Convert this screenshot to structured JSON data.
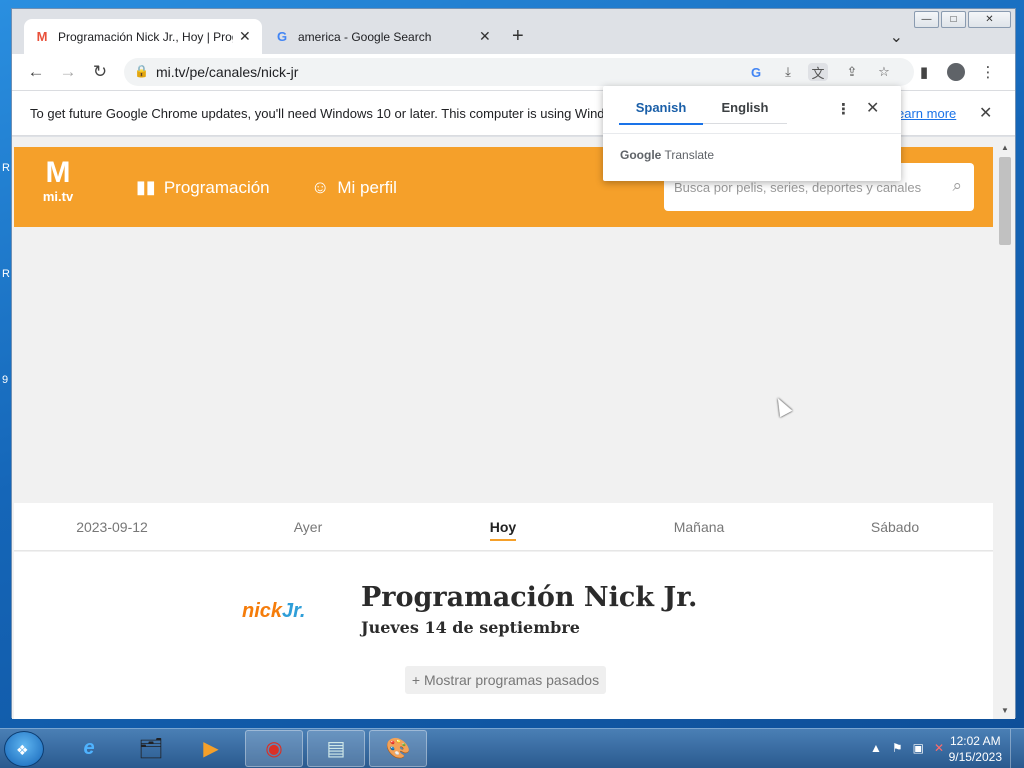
{
  "desktop": {
    "edge_letters": [
      "R",
      "R",
      "9"
    ]
  },
  "window": {
    "controls": {
      "minimize": "—",
      "maximize": "□",
      "close": "✕"
    }
  },
  "tabs": [
    {
      "title": "Programación Nick Jr., Hoy | Prog",
      "favicon": "M",
      "close": "✕"
    },
    {
      "title": "america - Google Search",
      "favicon": "G",
      "close": "✕"
    }
  ],
  "new_tab": "+",
  "tab_search": "⌄",
  "toolbar": {
    "back": "←",
    "forward": "→",
    "reload": "↻",
    "url": "mi.tv/pe/canales/nick-jr",
    "lock": "🔒",
    "icons": {
      "google": "G",
      "install": "⤓",
      "translate": "文",
      "share": "⇪",
      "bookmark": "☆",
      "side_panel": "▮",
      "menu": "⋮"
    }
  },
  "infobar": {
    "message": "To get future Google Chrome updates, you'll need Windows 10 or later. This computer is using Wind",
    "link": "earn more",
    "close": "✕"
  },
  "site": {
    "logo_mark": "M",
    "logo_text": "mi.tv",
    "nav": [
      {
        "label": "Programación",
        "icon": "book-open-icon"
      },
      {
        "label": "Mi perfil",
        "icon": "profile-face-icon"
      }
    ],
    "search_placeholder": "Busca por pelis, series, deportes y canales",
    "search_icon": "⌕"
  },
  "days": [
    {
      "label": "2023-09-12",
      "active": false
    },
    {
      "label": "Ayer",
      "active": false
    },
    {
      "label": "Hoy",
      "active": true
    },
    {
      "label": "Mañana",
      "active": false
    },
    {
      "label": "Sábado",
      "active": false
    }
  ],
  "channel": {
    "logo_nick": "nick",
    "logo_jr": "Jr.",
    "title": "Programación Nick Jr.",
    "date": "Jueves 14 de septiembre",
    "show_past": "+ Mostrar programas pasados"
  },
  "translate_popup": {
    "languages": [
      {
        "label": "Spanish",
        "active": true
      },
      {
        "label": "English",
        "active": false
      }
    ],
    "menu": "⋮",
    "close": "✕",
    "brand_google": "Google",
    "brand_translate": "Translate"
  },
  "scrollbar": {
    "up": "▲",
    "down": "▼"
  },
  "taskbar": {
    "apps": [
      "e",
      "🗂",
      "▶",
      "◉",
      "▤",
      "🎨"
    ],
    "tray": [
      "▲",
      "⚑",
      "▣",
      "✕"
    ],
    "time": "12:02 AM",
    "date": "9/15/2023"
  }
}
